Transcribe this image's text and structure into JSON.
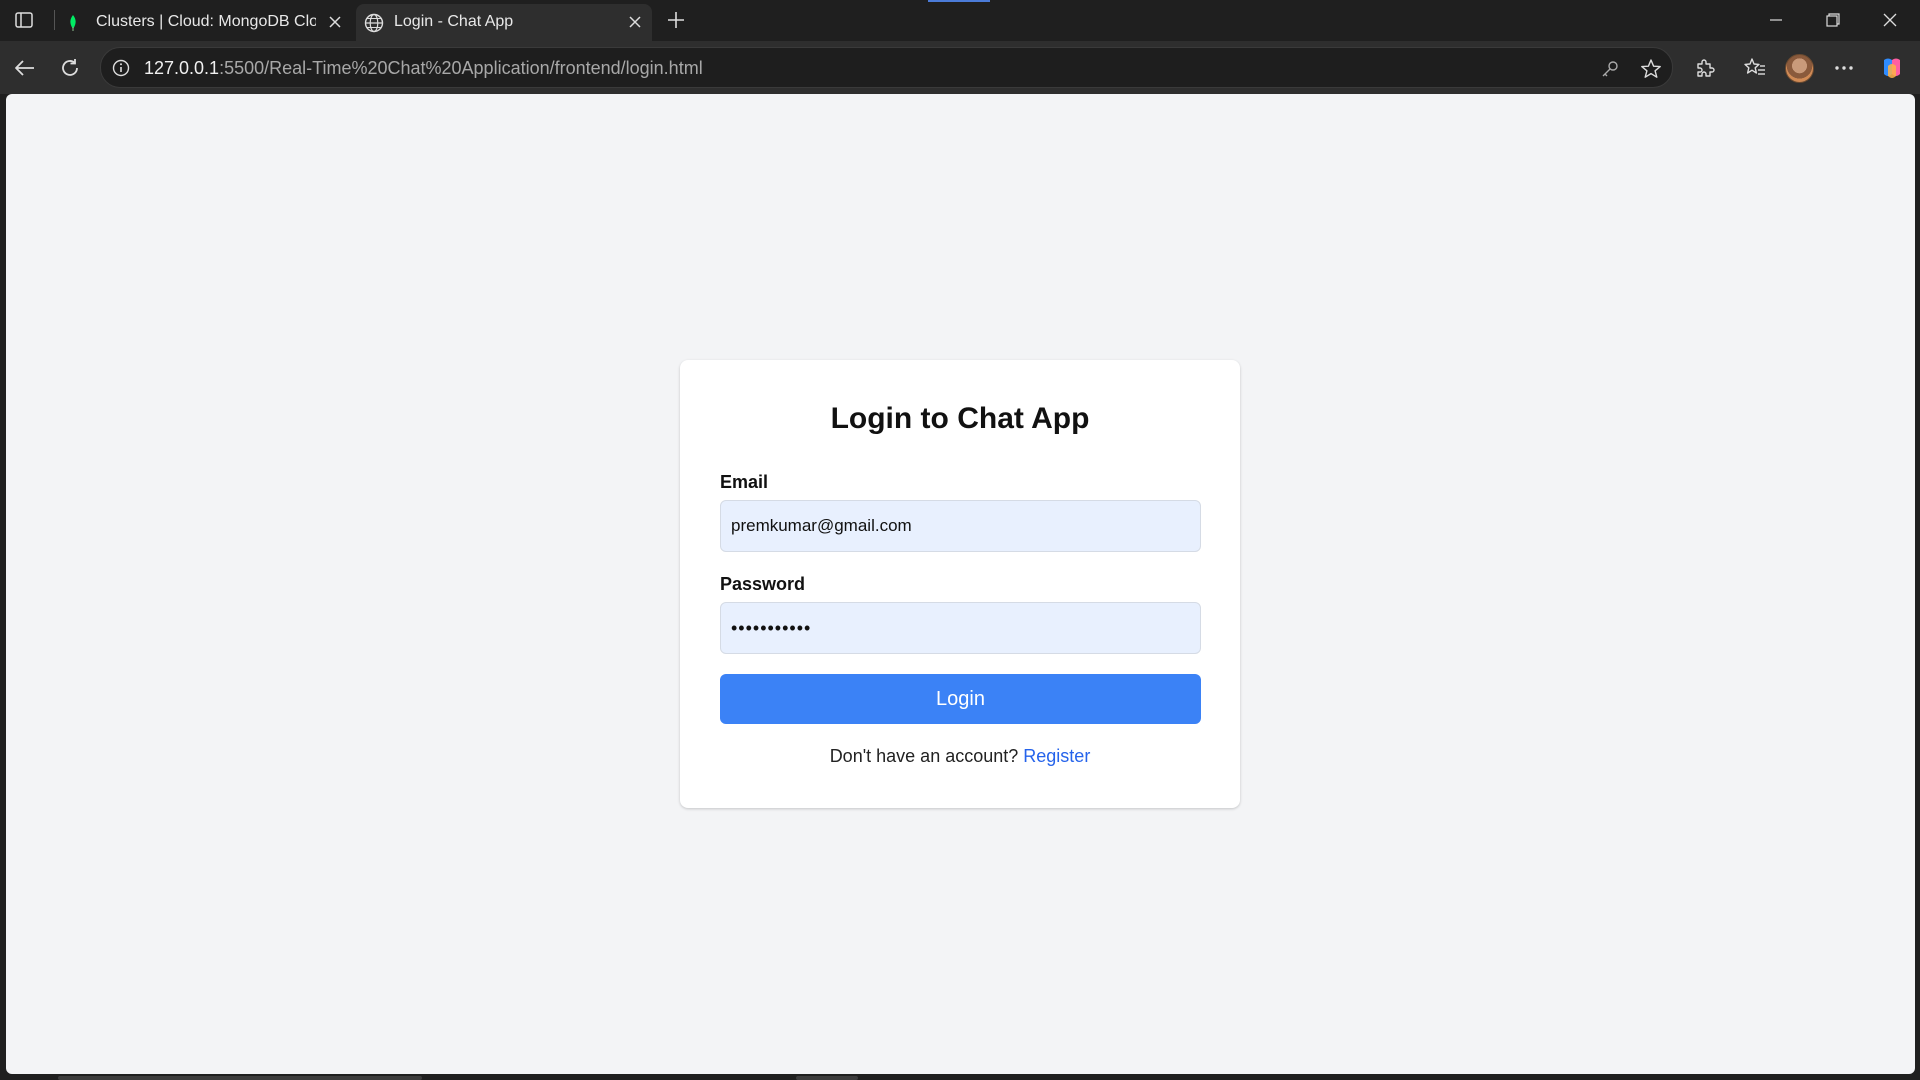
{
  "browser": {
    "tabs": [
      {
        "title": "Clusters | Cloud: MongoDB Cloud",
        "favicon": "mongodb-leaf-icon",
        "active": false
      },
      {
        "title": "Login - Chat App",
        "favicon": "globe-icon",
        "active": true
      }
    ],
    "url_host": "127.0.0.1",
    "url_rest": ":5500/Real-Time%20Chat%20Application/frontend/login.html"
  },
  "page": {
    "title": "Login to Chat App",
    "email_label": "Email",
    "email_value": "premkumar@gmail.com",
    "password_label": "Password",
    "password_value": "premkumar12",
    "login_button": "Login",
    "register_prompt": "Don't have an account?",
    "register_link": "Register"
  },
  "colors": {
    "page_background": "#f3f4f6",
    "primary_button": "#3b82f6",
    "link": "#2563eb",
    "input_autofill": "#e8f0fe",
    "browser_chrome": "#1f1f1f"
  }
}
